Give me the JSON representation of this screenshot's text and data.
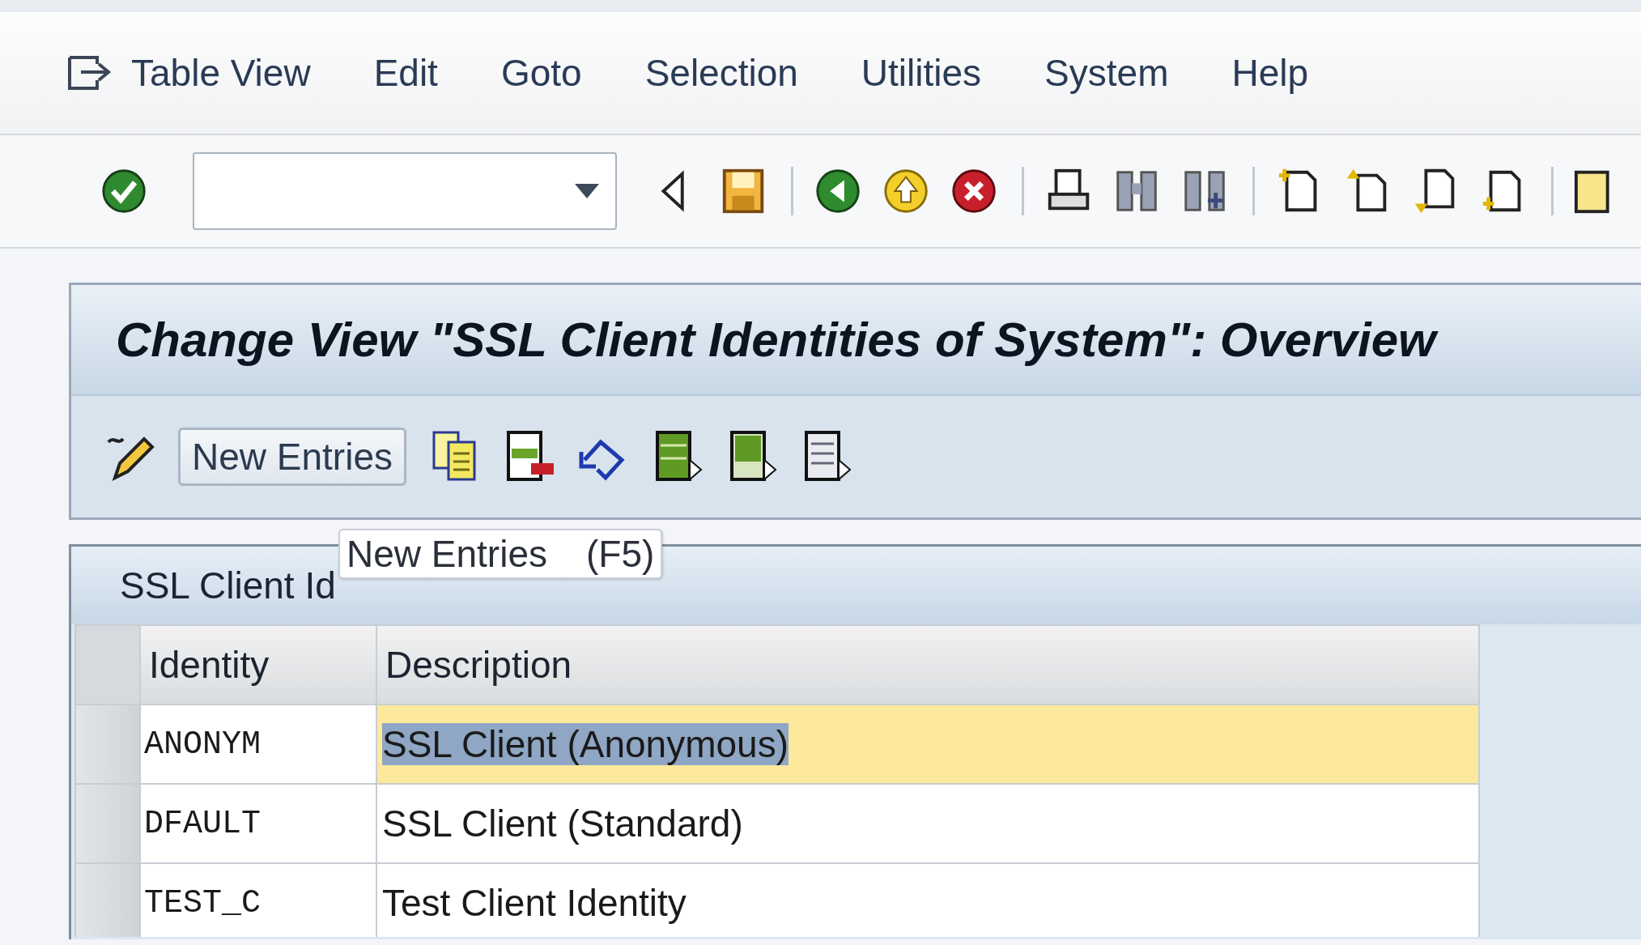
{
  "menu_bar": {
    "items": [
      {
        "label": "Table View"
      },
      {
        "label": "Edit"
      },
      {
        "label": "Goto"
      },
      {
        "label": "Selection"
      },
      {
        "label": "Utilities"
      },
      {
        "label": "System"
      },
      {
        "label": "Help"
      }
    ]
  },
  "title": "Change View \"SSL Client Identities of System\": Overview",
  "app_toolbar": {
    "button": "New Entries"
  },
  "tooltip": {
    "label": "New Entries",
    "shortcut": "(F5)"
  },
  "table": {
    "title": "SSL Client Id",
    "columns": [
      "Identity",
      "Description"
    ],
    "rows": [
      {
        "identity": "ANONYM",
        "description": "SSL Client (Anonymous)",
        "selected": true
      },
      {
        "identity": "DFAULT",
        "description": "SSL Client (Standard)",
        "selected": false
      },
      {
        "identity": "TEST_C",
        "description": "Test Client Identity",
        "selected": false
      }
    ]
  }
}
